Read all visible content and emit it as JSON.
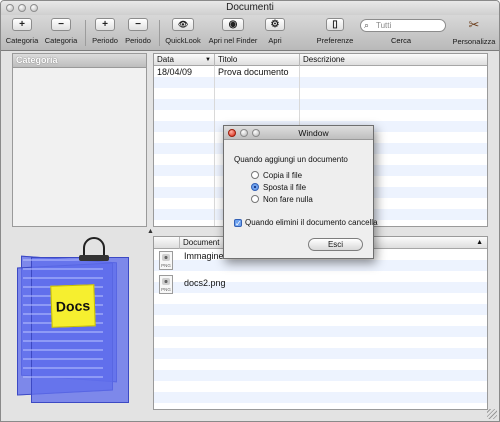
{
  "window": {
    "title": "Documenti"
  },
  "toolbar": {
    "items": [
      {
        "label": "Categoria",
        "glyph": "+",
        "icon": "add-icon"
      },
      {
        "label": "Categoria",
        "glyph": "−",
        "icon": "remove-icon"
      },
      {
        "label": "Periodo",
        "glyph": "+",
        "icon": "add-icon"
      },
      {
        "label": "Periodo",
        "glyph": "−",
        "icon": "remove-icon"
      },
      {
        "label": "QuickLook",
        "glyph": "👁",
        "icon": "eye-icon"
      },
      {
        "label": "Apri nel Finder",
        "glyph": "◉",
        "icon": "finder-icon"
      },
      {
        "label": "Apri",
        "glyph": "⚙",
        "icon": "gear-icon"
      },
      {
        "label": "Preferenze",
        "glyph": "▯",
        "icon": "switch-icon"
      },
      {
        "label": "Personalizza",
        "glyph": "✂",
        "icon": "tools-icon"
      }
    ],
    "search": {
      "placeholder": "Tutti",
      "label": "Cerca"
    }
  },
  "left_pane": {
    "header": "Categoria"
  },
  "upper_table": {
    "columns": [
      "Data",
      "Titolo",
      "Descrizione"
    ],
    "rows": [
      {
        "data": "18/04/09",
        "titolo": "Prova documento",
        "descrizione": ""
      }
    ]
  },
  "lower_table": {
    "columns": [
      "Document"
    ],
    "rows": [
      {
        "name": "Immagine",
        "icon_text": "PNG"
      },
      {
        "name": "docs2.png",
        "icon_text": "PNG"
      }
    ]
  },
  "illustration": {
    "postit_text": "Docs"
  },
  "dialog": {
    "title": "Window",
    "question": "Quando aggiungi un documento",
    "options": [
      {
        "label": "Copia il file",
        "selected": false
      },
      {
        "label": "Sposta il file",
        "selected": true
      },
      {
        "label": "Non fare nulla",
        "selected": false
      }
    ],
    "checkbox_label": "Quando elimini il documento cancella",
    "checkbox_checked": true,
    "button": "Esci"
  },
  "colors": {
    "accent": "#3461b5",
    "stripe": "#edf3fe",
    "dialog_close": "#d8210e",
    "postit": "#f6ef2f"
  }
}
